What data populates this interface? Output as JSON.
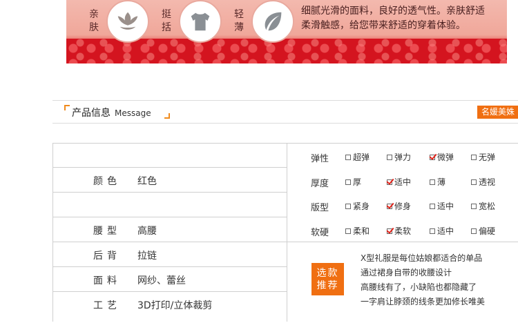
{
  "banner": {
    "features": [
      {
        "label": "亲肤",
        "icon": "lotus-icon"
      },
      {
        "label": "挺括",
        "icon": "tshirt-icon"
      },
      {
        "label": "轻薄",
        "icon": "leaf-icon"
      }
    ],
    "description_lines": [
      "细腻光滑的面料，良好的透气性。亲肤舒适",
      "柔滑触感，给您带来舒适的穿着体验。"
    ]
  },
  "info_header": {
    "title": "产品信息",
    "title_en": "Message",
    "brand": "名媛美姝"
  },
  "attributes": [
    {
      "key": "",
      "value": ""
    },
    {
      "key": "颜色",
      "value": "红色"
    },
    {
      "key": "",
      "value": ""
    },
    {
      "key": "腰型",
      "value": "高腰"
    },
    {
      "key": "后背",
      "value": "拉链"
    },
    {
      "key": "面料",
      "value": "网纱、蕾丝"
    },
    {
      "key": "工艺",
      "value": "3D打印/立体裁剪"
    }
  ],
  "options": [
    {
      "name": "弹性",
      "choices": [
        {
          "label": "超弹",
          "checked": false
        },
        {
          "label": "弹力",
          "checked": false
        },
        {
          "label": "微弹",
          "checked": true
        },
        {
          "label": "无弹",
          "checked": false
        }
      ]
    },
    {
      "name": "厚度",
      "choices": [
        {
          "label": "厚",
          "checked": false
        },
        {
          "label": "适中",
          "checked": true
        },
        {
          "label": "薄",
          "checked": false
        },
        {
          "label": "透视",
          "checked": false
        }
      ]
    },
    {
      "name": "版型",
      "choices": [
        {
          "label": "紧身",
          "checked": false
        },
        {
          "label": "修身",
          "checked": true
        },
        {
          "label": "适中",
          "checked": false
        },
        {
          "label": "宽松",
          "checked": false
        }
      ]
    },
    {
      "name": "软硬",
      "choices": [
        {
          "label": "柔和",
          "checked": false
        },
        {
          "label": "柔软",
          "checked": true
        },
        {
          "label": "适中",
          "checked": false
        },
        {
          "label": "偏硬",
          "checked": false
        }
      ]
    }
  ],
  "recommend": {
    "button_line1": "选款",
    "button_line2": "推荐",
    "lines": [
      "X型礼服是每位姑娘都适合的单品",
      "通过裙身自带的收腰设计",
      "高腰线有了，小缺陷也都隐藏了",
      "一字肩让脖颈的线条更加修长唯美"
    ]
  },
  "colors": {
    "accent": "#f06f12",
    "check": "#e2231a",
    "banner_red": "#d8121d"
  }
}
